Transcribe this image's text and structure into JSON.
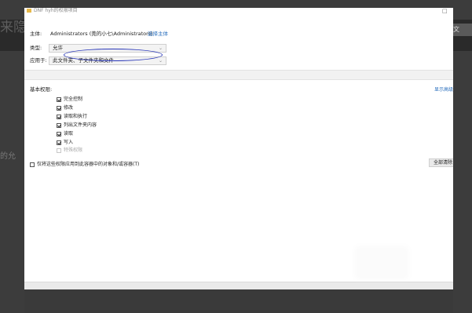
{
  "background": {
    "left_text": "来隐",
    "right_text": "文",
    "mid_text": "的允"
  },
  "dialog": {
    "title": "DNF hyh的权限项目",
    "maximize_glyph": "□"
  },
  "principal": {
    "label": "主体:",
    "value": "Administrators (莞的小七\\Administrators)",
    "link": "选择主体"
  },
  "type": {
    "label": "类型:",
    "selected": "允许",
    "caret": "⌄"
  },
  "applies_to": {
    "label": "应用于:",
    "selected": "此文件夹、子文件夹和文件",
    "caret": "⌄"
  },
  "permissions": {
    "title": "基本权限:",
    "advanced_link": "显示高级",
    "items": [
      {
        "label": "完全控制",
        "checked": true,
        "disabled": false
      },
      {
        "label": "修改",
        "checked": true,
        "disabled": false
      },
      {
        "label": "读取和执行",
        "checked": true,
        "disabled": false
      },
      {
        "label": "列出文件夹内容",
        "checked": true,
        "disabled": false
      },
      {
        "label": "读取",
        "checked": true,
        "disabled": false
      },
      {
        "label": "写入",
        "checked": true,
        "disabled": false
      },
      {
        "label": "特殊权限",
        "checked": false,
        "disabled": true
      }
    ]
  },
  "apply_only": {
    "label": "仅将这些权限应用到此容器中的对象和/或容器(T)",
    "checked": false
  },
  "clear_all_button": "全部清除",
  "colors": {
    "link": "#2a6fbd",
    "annotation": "#2735b8"
  }
}
